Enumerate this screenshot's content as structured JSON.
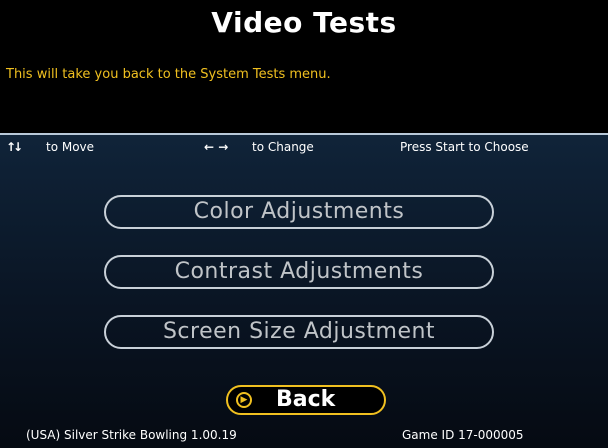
{
  "screen": {
    "title": "Video Tests",
    "description": "This will take you back to the System Tests menu."
  },
  "hints": {
    "move_icon": "↑↓",
    "move_label": "to Move",
    "change_icon": "← →",
    "change_label": "to Change",
    "choose_label": "Press Start to Choose"
  },
  "menu": {
    "items": [
      {
        "label": "Color Adjustments"
      },
      {
        "label": "Contrast Adjustments"
      },
      {
        "label": "Screen Size Adjustment"
      }
    ],
    "back_label": "Back",
    "selected": "Back"
  },
  "footer": {
    "version": "(USA) Silver Strike Bowling 1.00.19",
    "game_id": "Game ID 17-000005"
  },
  "colors": {
    "accent": "#f0c020",
    "text": "#ffffff",
    "button_text": "#c0c4c8"
  }
}
